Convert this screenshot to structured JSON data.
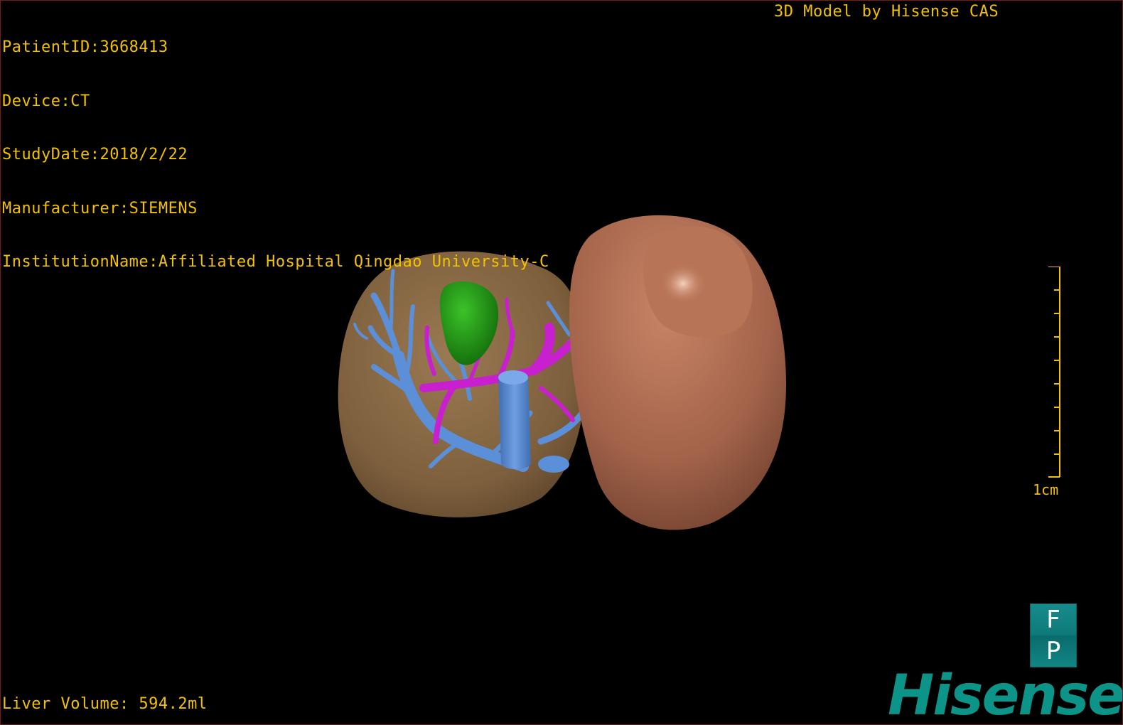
{
  "header": {
    "patient_id": "PatientID:3668413",
    "device": "Device:CT",
    "study_date": "StudyDate:2018/2/22",
    "manufacturer": "Manufacturer:SIEMENS",
    "institution": "InstitutionName:Affiliated Hospital Qingdao University-C",
    "credit": "3D Model by Hisense CAS"
  },
  "footer": {
    "liver_volume": "Liver Volume: 594.2ml"
  },
  "scale": {
    "label": "1cm"
  },
  "orientation": {
    "top": "F",
    "bottom": "P"
  },
  "brand": {
    "logo_text": "Hisense"
  },
  "colors": {
    "overlay_text": "#f2c200",
    "liver": "#8a6a45",
    "tumor": "#1f9a12",
    "portal_vein": "#5b8fd8",
    "hepatic_vein": "#c81fcf",
    "spleen": "#a8694e",
    "brand": "#0d9488"
  }
}
